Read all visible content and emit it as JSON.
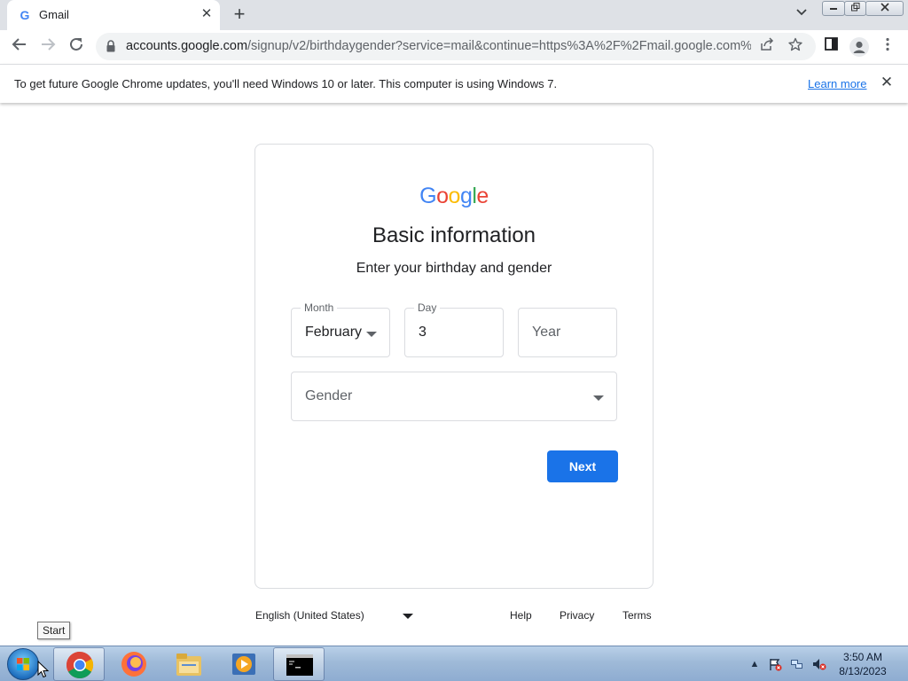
{
  "browser": {
    "tab": {
      "title": "Gmail",
      "favicon": "G"
    },
    "address": {
      "host": "accounts.google.com",
      "path": "/signup/v2/birthdaygender?service=mail&continue=https%3A%2F%2Fmail.google.com%2..."
    },
    "infobar": {
      "message": "To get future Google Chrome updates, you'll need Windows 10 or later. This computer is using Windows 7.",
      "link": "Learn more"
    }
  },
  "signup": {
    "logo": {
      "letters": [
        "G",
        "o",
        "o",
        "g",
        "l",
        "e"
      ],
      "colors": [
        "#4285f4",
        "#ea4335",
        "#fbbc05",
        "#4285f4",
        "#34a853",
        "#ea4335"
      ]
    },
    "title": "Basic information",
    "subtitle": "Enter your birthday and gender",
    "month": {
      "label": "Month",
      "value": "February"
    },
    "day": {
      "label": "Day",
      "value": "3"
    },
    "year": {
      "placeholder": "Year"
    },
    "gender": {
      "placeholder": "Gender"
    },
    "next_label": "Next"
  },
  "footer": {
    "language": "English (United States)",
    "links": [
      "Help",
      "Privacy",
      "Terms"
    ]
  },
  "tooltip": "Start",
  "taskbar": {
    "apps": [
      "chrome-icon",
      "firefox-icon",
      "file-explorer-icon",
      "media-player-icon",
      "command-prompt-icon"
    ],
    "clock_time": "3:50 AM",
    "clock_date": "8/13/2023"
  },
  "accent_color": "#1a73e8"
}
